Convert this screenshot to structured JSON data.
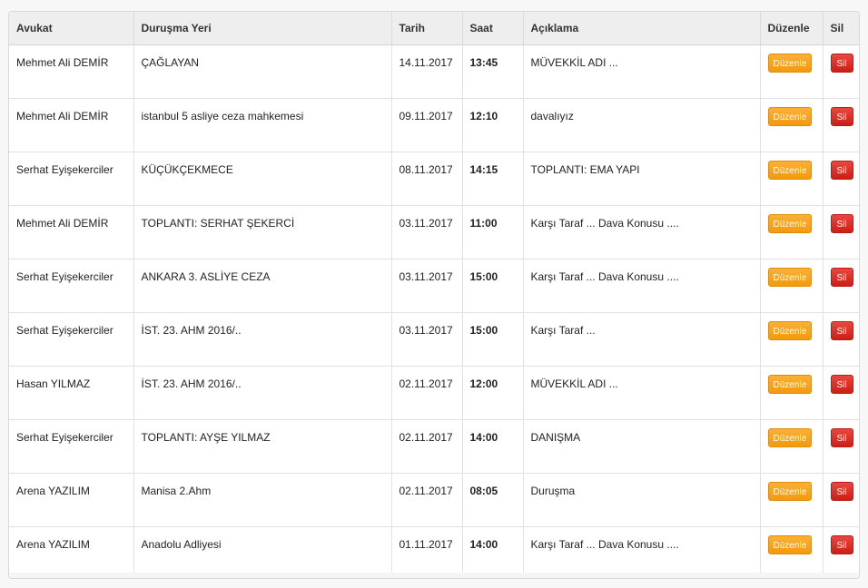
{
  "table": {
    "headers": [
      "Avukat",
      "Duruşma Yeri",
      "Tarih",
      "Saat",
      "Açıklama",
      "Düzenle",
      "Sil"
    ],
    "rows": [
      {
        "lawyer": "Mehmet Ali DEMİR",
        "place": "ÇAĞLAYAN",
        "date": "14.11.2017",
        "time": "13:45",
        "desc": "MÜVEKKİL ADI ...",
        "edit": "Düzenle",
        "delete": "Sil"
      },
      {
        "lawyer": "Mehmet Ali DEMİR",
        "place": "istanbul 5 asliye ceza mahkemesi",
        "date": "09.11.2017",
        "time": "12:10",
        "desc": "davalıyız",
        "edit": "Düzenle",
        "delete": "Sil"
      },
      {
        "lawyer": "Serhat Eyişekerciler",
        "place": "KÜÇÜKÇEKMECE",
        "date": "08.11.2017",
        "time": "14:15",
        "desc": "TOPLANTI: EMA YAPI",
        "edit": "Düzenle",
        "delete": "Sil"
      },
      {
        "lawyer": "Mehmet Ali DEMİR",
        "place": "TOPLANTI: SERHAT ŞEKERCİ",
        "date": "03.11.2017",
        "time": "11:00",
        "desc": "Karşı Taraf ... Dava Konusu ....",
        "edit": "Düzenle",
        "delete": "Sil"
      },
      {
        "lawyer": "Serhat Eyişekerciler",
        "place": "ANKARA 3. ASLİYE CEZA",
        "date": "03.11.2017",
        "time": "15:00",
        "desc": "Karşı Taraf ... Dava Konusu ....",
        "edit": "Düzenle",
        "delete": "Sil"
      },
      {
        "lawyer": "Serhat Eyişekerciler",
        "place": "İST. 23. AHM 2016/..",
        "date": "03.11.2017",
        "time": "15:00",
        "desc": "Karşı Taraf ...",
        "edit": "Düzenle",
        "delete": "Sil"
      },
      {
        "lawyer": "Hasan YILMAZ",
        "place": "İST. 23. AHM 2016/..",
        "date": "02.11.2017",
        "time": "12:00",
        "desc": "MÜVEKKİL ADI ...",
        "edit": "Düzenle",
        "delete": "Sil"
      },
      {
        "lawyer": "Serhat Eyişekerciler",
        "place": "TOPLANTI: AYŞE YILMAZ",
        "date": "02.11.2017",
        "time": "14:00",
        "desc": "DANIŞMA",
        "edit": "Düzenle",
        "delete": "Sil"
      },
      {
        "lawyer": "Arena YAZILIM",
        "place": "Manisa 2.Ahm",
        "date": "02.11.2017",
        "time": "08:05",
        "desc": "Duruşma",
        "edit": "Düzenle",
        "delete": "Sil"
      },
      {
        "lawyer": "Arena YAZILIM",
        "place": "Anadolu Adliyesi",
        "date": "01.11.2017",
        "time": "14:00",
        "desc": "Karşı Taraf ... Dava Konusu ....",
        "edit": "Düzenle",
        "delete": "Sil"
      }
    ]
  },
  "colors": {
    "edit_button": "#f5a623",
    "delete_button": "#d9291f",
    "header_background": "#eeeeee"
  }
}
